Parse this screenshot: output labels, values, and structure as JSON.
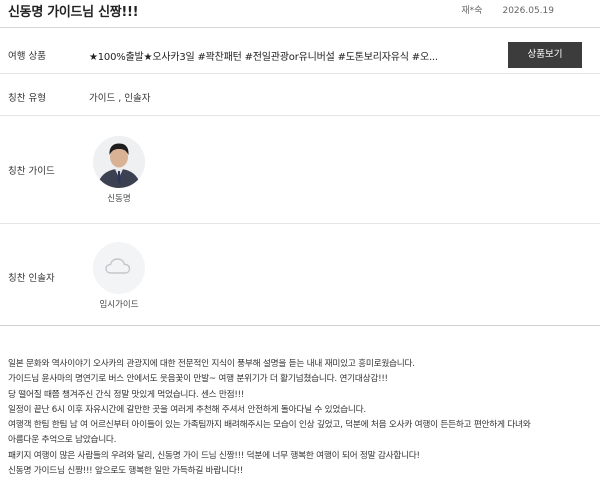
{
  "header": {
    "title": "신동명 가이드님 신짱!!!",
    "author": "재*숙",
    "date": "2026.05.19"
  },
  "product": {
    "label": "여행 상품",
    "value": "★100%출발★오사카3일 #꽉찬패턴 #전일관광or유니버설 #도톤보리자유식 #오...",
    "button_label": "상품보기"
  },
  "praise_type": {
    "label": "칭찬 유형",
    "value": "가이드 , 인솔자"
  },
  "praise_guide": {
    "label": "칭찬 가이드",
    "name": "신동명",
    "avatar_icon": "person-photo"
  },
  "praise_assistant": {
    "label": "칭찬 인솔자",
    "name": "임시가이드",
    "avatar_icon": "cloud-icon"
  },
  "review": [
    "일본 문화와 역사이야기 오사카의 관광지에 대한 전문적인 지식이 풍부해 설명을 듣는 내내 재미있고 흥미로웠습니다.",
    "가이드님 윤사마의 명연기로 버스 안에서도 웃음꽃이 만발~ 여행 분위기가 더 활기넘쳤습니다. 연기대상감!!!",
    "당 떨어질 때쯤 챙겨주신 간식 정말 맛있게 먹었습니다. 센스 만점!!!",
    "일정이 끝난 6시 이후 자유시간에 갈만한 곳을 여러게 추천해 주셔서 안전하게 돌아다닐 수 있었습니다.",
    "여행객 한팀 한팀 남 여 어르신부터 아이들이 있는 가족팀까지 배려해주시는 모습이 인상 깊었고, 덕분에 처음 오사카 여행이 든든하고 편안하게 다녀와",
    "아름다운 추억으로 남았습니다.",
    "패키지 여행이 많은 사람들의 우려와 달리, 신동명 가이 드님 신짱!!! 덕분에 너무 행복한 여행이 되어 정말 감사합니다!",
    "신동명 가이드님 신짱!!! 앞으로도 행복한 일만 가득하길 바랍니다!!"
  ]
}
